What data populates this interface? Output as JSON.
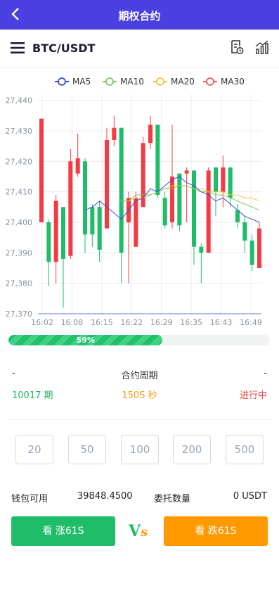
{
  "page": {
    "title": "期权合约"
  },
  "header": {
    "pair": "BTC/USDT"
  },
  "colors": {
    "up": "#1fbd6a",
    "down": "#f23b43",
    "brand": "#4a3fe0",
    "accent": "#ff9900",
    "ma5": "#3a4bd6",
    "ma10": "#7ccb62",
    "ma20": "#f2c53a",
    "ma30": "#ec5a5a"
  },
  "icons": {
    "back": "chevron-left-icon",
    "menu": "hamburger-menu-icon",
    "record": "order-record-icon",
    "chart": "chart-bars-icon"
  },
  "chart_data": {
    "type": "candlestick",
    "legend": [
      "MA5",
      "MA10",
      "MA20",
      "MA30"
    ],
    "x_ticks": [
      "16:02",
      "16:08",
      "16:15",
      "16:22",
      "16:29",
      "16:35",
      "16:43",
      "16:49"
    ],
    "y_ticks": [
      "27,440",
      "27,430",
      "27,420",
      "27,410",
      "27,400",
      "27,390",
      "27,380",
      "27,370"
    ],
    "ylim": [
      27370,
      27442
    ],
    "candles": [
      {
        "o": 27400,
        "c": 27434,
        "h": 27434,
        "l": 27400
      },
      {
        "o": 27400,
        "c": 27387,
        "h": 27401,
        "l": 27379
      },
      {
        "o": 27387,
        "c": 27407,
        "h": 27409,
        "l": 27380
      },
      {
        "o": 27405,
        "c": 27388,
        "h": 27405,
        "l": 27372
      },
      {
        "o": 27389,
        "c": 27420,
        "h": 27424,
        "l": 27388
      },
      {
        "o": 27416,
        "c": 27421,
        "h": 27429,
        "l": 27415
      },
      {
        "o": 27420,
        "c": 27396,
        "h": 27421,
        "l": 27390
      },
      {
        "o": 27405,
        "c": 27396,
        "h": 27406,
        "l": 27392
      },
      {
        "o": 27405,
        "c": 27391,
        "h": 27407,
        "l": 27387
      },
      {
        "o": 27398,
        "c": 27427,
        "h": 27431,
        "l": 27398
      },
      {
        "o": 27427,
        "c": 27431,
        "h": 27435,
        "l": 27425
      },
      {
        "o": 27431,
        "c": 27390,
        "h": 27431,
        "l": 27380
      },
      {
        "o": 27400,
        "c": 27408,
        "h": 27410,
        "l": 27380
      },
      {
        "o": 27392,
        "c": 27408,
        "h": 27410,
        "l": 27392
      },
      {
        "o": 27405,
        "c": 27426,
        "h": 27428,
        "l": 27405
      },
      {
        "o": 27426,
        "c": 27432,
        "h": 27435,
        "l": 27424
      },
      {
        "o": 27432,
        "c": 27409,
        "h": 27432,
        "l": 27408
      },
      {
        "o": 27408,
        "c": 27399,
        "h": 27410,
        "l": 27398
      },
      {
        "o": 27400,
        "c": 27415,
        "h": 27432,
        "l": 27398
      },
      {
        "o": 27416,
        "c": 27399,
        "h": 27416,
        "l": 27397
      },
      {
        "o": 27416,
        "c": 27417,
        "h": 27418,
        "l": 27400
      },
      {
        "o": 27417,
        "c": 27392,
        "h": 27417,
        "l": 27386
      },
      {
        "o": 27392,
        "c": 27390,
        "h": 27393,
        "l": 27380
      },
      {
        "o": 27390,
        "c": 27417,
        "h": 27418,
        "l": 27390
      },
      {
        "o": 27418,
        "c": 27410,
        "h": 27418,
        "l": 27402
      },
      {
        "o": 27410,
        "c": 27418,
        "h": 27422,
        "l": 27405
      },
      {
        "o": 27418,
        "c": 27408,
        "h": 27418,
        "l": 27405
      },
      {
        "o": 27404,
        "c": 27400,
        "h": 27406,
        "l": 27398
      },
      {
        "o": 27400,
        "c": 27394,
        "h": 27402,
        "l": 27390
      },
      {
        "o": 27394,
        "c": 27386,
        "h": 27396,
        "l": 27384
      },
      {
        "o": 27385,
        "c": 27398,
        "h": 27400,
        "l": 27385
      }
    ],
    "ma5": [
      null,
      null,
      null,
      null,
      null,
      null,
      27404,
      27405,
      27407,
      27405,
      27403,
      27401,
      27404,
      27407,
      27408,
      27411,
      27410,
      27412,
      27414,
      27415,
      27413,
      27412,
      27410,
      27409,
      27407,
      27408,
      27406,
      27404,
      27402,
      27401,
      27400
    ],
    "ma10": [
      null,
      null,
      null,
      null,
      null,
      null,
      null,
      null,
      null,
      null,
      null,
      27407,
      27407,
      27409,
      27409,
      27409,
      27410,
      27411,
      27411,
      27412,
      27412,
      27411,
      27410,
      27410,
      27409,
      27409,
      27408,
      27407,
      27406,
      27405,
      27404
    ],
    "ma20": [
      null,
      null,
      null,
      null,
      null,
      null,
      null,
      null,
      null,
      null,
      null,
      27407,
      27407,
      27408,
      27408,
      27409,
      27410,
      27411,
      27412,
      27412,
      27412,
      27411,
      27411,
      27410,
      27410,
      27410,
      27409,
      27409,
      27408,
      27408,
      27407
    ],
    "ma30": [
      null,
      null,
      null,
      null,
      null,
      null,
      null,
      null,
      null,
      null,
      null,
      null,
      null,
      null,
      null,
      null,
      null,
      null,
      null,
      null,
      null,
      null,
      null,
      null,
      null,
      null,
      null,
      null,
      null,
      null,
      null
    ]
  },
  "progress": {
    "percent": 59,
    "label": "59%"
  },
  "info": {
    "left_dash": "-",
    "period_label": "合约周期",
    "right_dash": "-",
    "period_value": "10017 期",
    "seconds": "150S 秒",
    "status": "进行中"
  },
  "amounts": [
    "20",
    "50",
    "100",
    "200",
    "500"
  ],
  "wallet": {
    "label": "钱包可用",
    "value": "39848.4500",
    "entrust_label": "委托数量",
    "entrust_value": "0 USDT"
  },
  "buttons": {
    "up": "看 涨61S",
    "down": "看 跌61S",
    "vs_v": "V",
    "vs_s": "s"
  }
}
